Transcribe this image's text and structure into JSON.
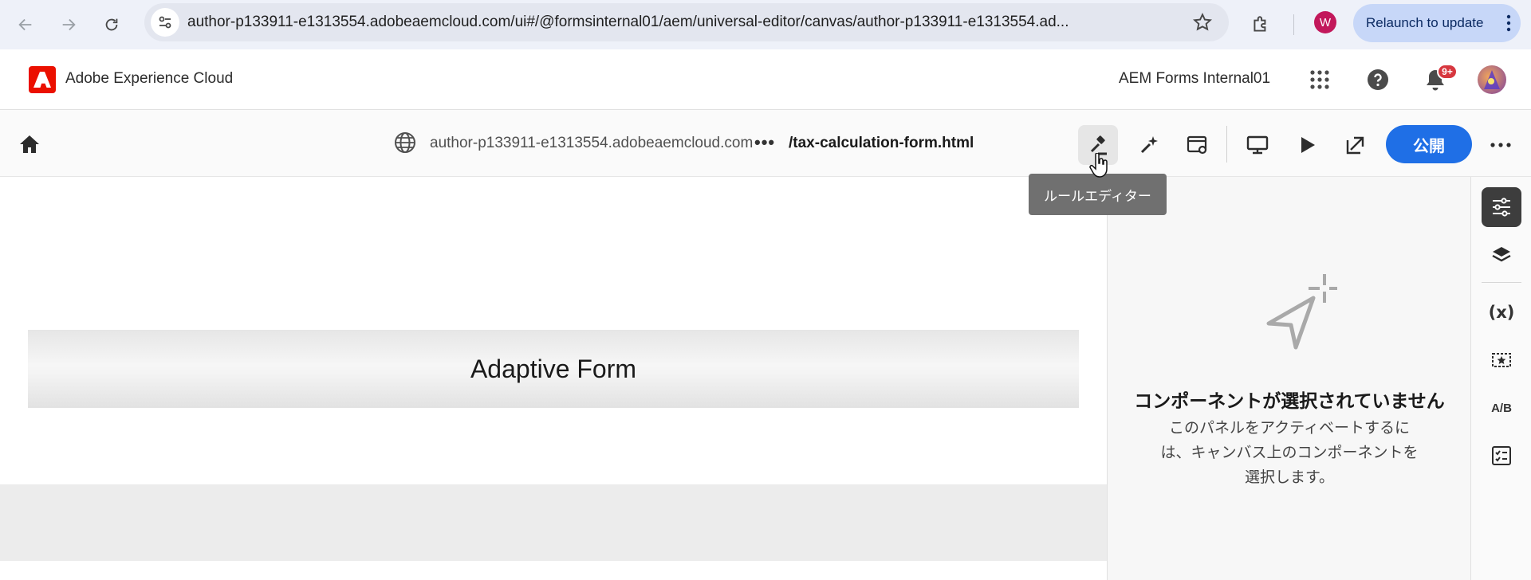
{
  "browser": {
    "url": "author-p133911-e1313554.adobeaemcloud.com/ui#/@formsinternal01/aem/universal-editor/canvas/author-p133911-e1313554.ad...",
    "profile_initial": "W",
    "relaunch_label": "Relaunch to update"
  },
  "header": {
    "app_title": "Adobe Experience Cloud",
    "org_name": "AEM Forms Internal01",
    "notification_count": "9+"
  },
  "toolbar": {
    "host": "author-p133911-e1313554.adobeaemcloud.com",
    "path_more": "•••",
    "path": "/tax-calculation-form.html",
    "publish_label": "公開",
    "tooltip": "ルールエディター"
  },
  "canvas": {
    "form_title": "Adaptive Form"
  },
  "panel": {
    "empty_title": "コンポーネントが選択されていません",
    "empty_desc": "このパネルをアクティベートするには、キャンバス上のコンポーネントを選択します。"
  },
  "rail": {
    "variables_label": "(x)",
    "ab_label": "A/B"
  },
  "colors": {
    "accent": "#1f6fe6",
    "adobe_red": "#eb1000",
    "badge": "#d7373f"
  }
}
